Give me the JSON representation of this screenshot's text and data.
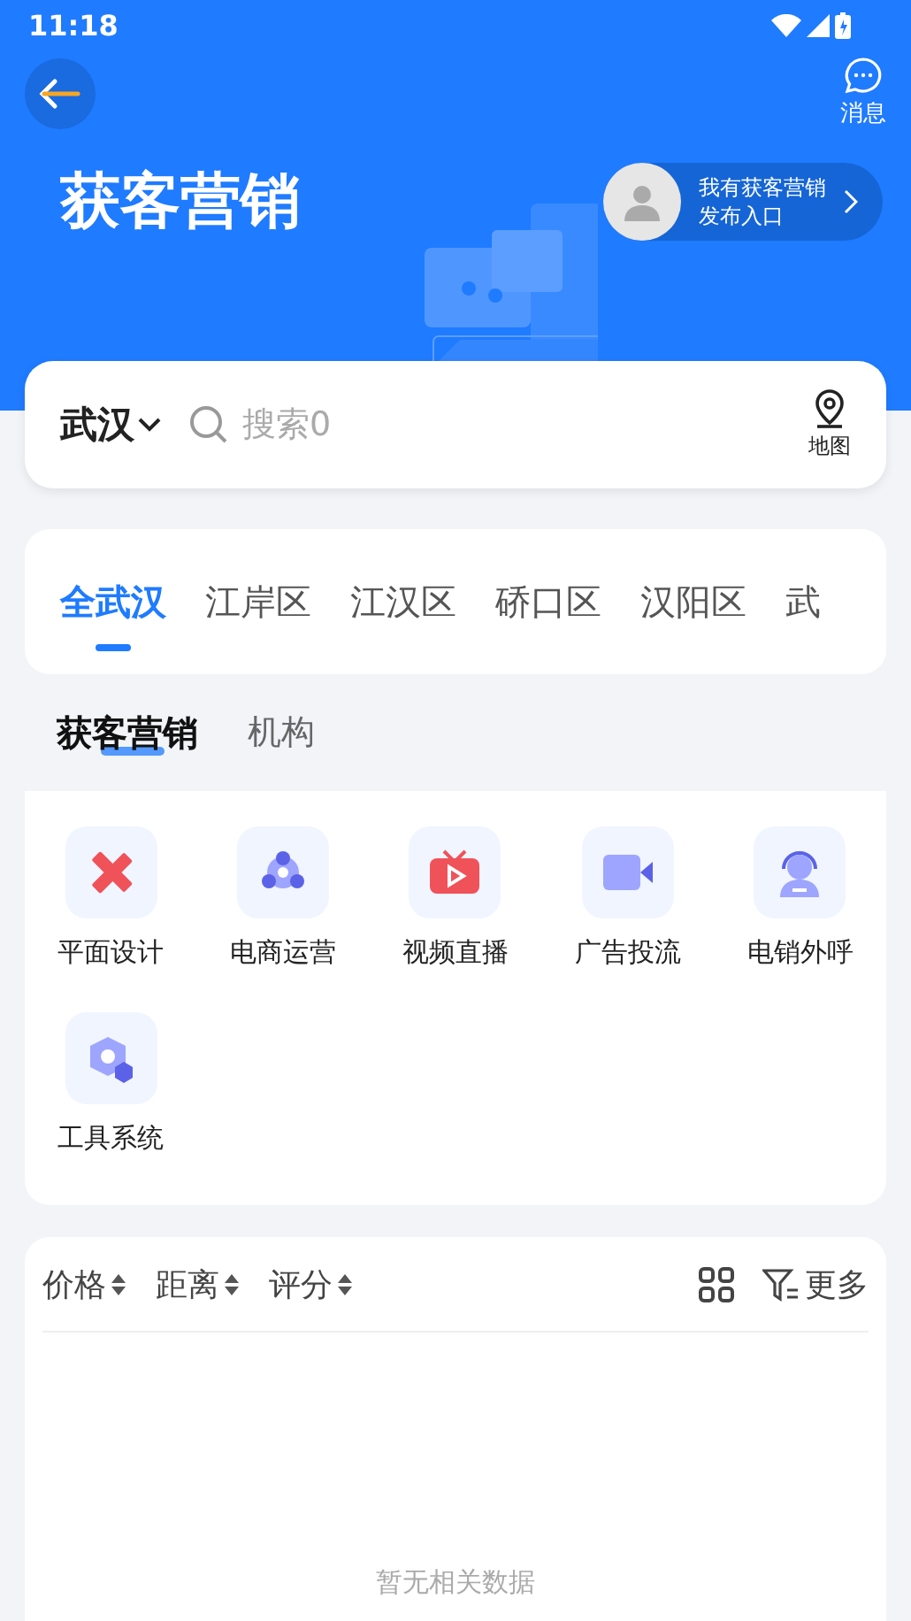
{
  "status_bar": {
    "time": "11:18"
  },
  "header": {
    "title": "获客营销",
    "messages_label": "消息",
    "publish": {
      "line1": "我有获客营销",
      "line2": "发布入口"
    }
  },
  "search": {
    "city": "武汉",
    "placeholder": "搜索0",
    "map_label": "地图"
  },
  "districts": [
    {
      "label": "全武汉",
      "selected": true
    },
    {
      "label": "江岸区",
      "selected": false
    },
    {
      "label": "江汉区",
      "selected": false
    },
    {
      "label": "硚口区",
      "selected": false
    },
    {
      "label": "汉阳区",
      "selected": false
    },
    {
      "label": "武",
      "selected": false
    }
  ],
  "sections": [
    {
      "label": "获客营销",
      "selected": true
    },
    {
      "label": "机构",
      "selected": false
    }
  ],
  "categories": [
    {
      "label": "平面设计",
      "kind": "design"
    },
    {
      "label": "电商运营",
      "kind": "ecommerce"
    },
    {
      "label": "视频直播",
      "kind": "video"
    },
    {
      "label": "广告投流",
      "kind": "ads"
    },
    {
      "label": "电销外呼",
      "kind": "call"
    },
    {
      "label": "工具系统",
      "kind": "tools"
    }
  ],
  "filters": {
    "sort_options": [
      {
        "label": "价格"
      },
      {
        "label": "距离"
      },
      {
        "label": "评分"
      }
    ],
    "more_label": "更多"
  },
  "empty_message": "暂无相关数据"
}
